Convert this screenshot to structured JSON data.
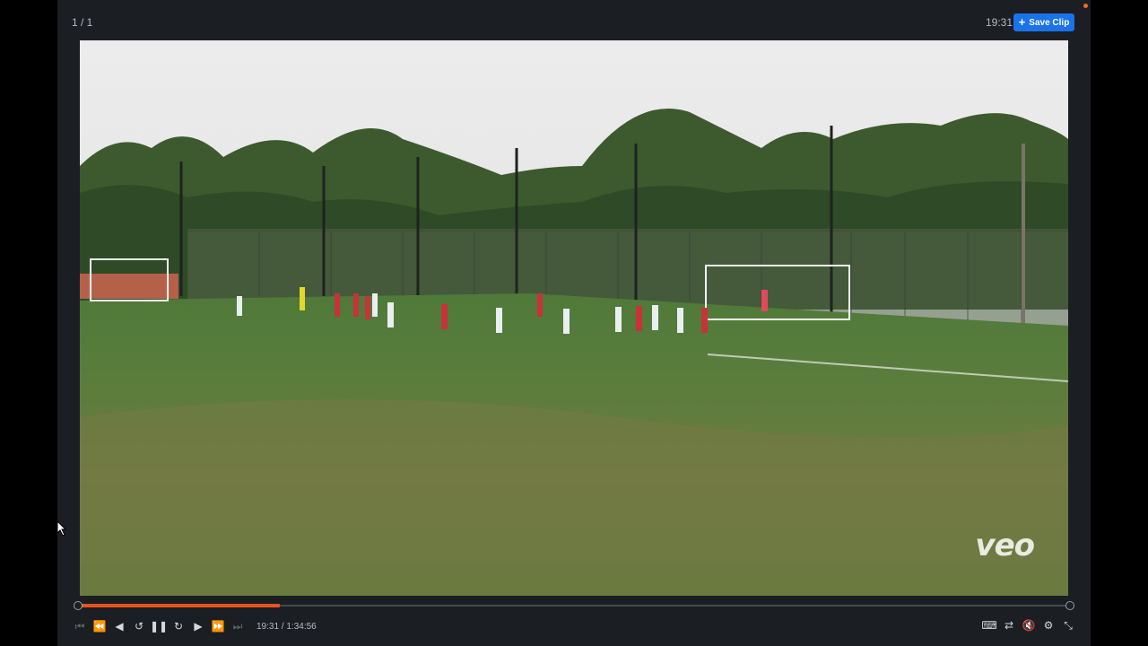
{
  "header": {
    "counter": "1 / 1",
    "time": "19:31",
    "save_clip_label": "Save Clip"
  },
  "video": {
    "watermark": "veo"
  },
  "player": {
    "timecode": "19:31 / 1:34:56",
    "progress_fraction": 0.204
  },
  "icons": {
    "plus": "plus-icon",
    "skip_start": "skip-start-icon",
    "rewind": "rewind-icon",
    "step_back": "step-back-icon",
    "replay": "replay-icon",
    "pause": "pause-icon",
    "forward": "forward-icon",
    "play_next": "play-icon",
    "fast_forward": "fast-forward-icon",
    "skip_end": "skip-end-icon",
    "keyboard": "keyboard-icon",
    "loop": "loop-icon",
    "mute": "volume-mute-icon",
    "settings": "gear-icon",
    "exit_fullscreen": "exit-fullscreen-icon"
  },
  "colors": {
    "accent": "#1a73e8",
    "progress": "#e8531d"
  }
}
